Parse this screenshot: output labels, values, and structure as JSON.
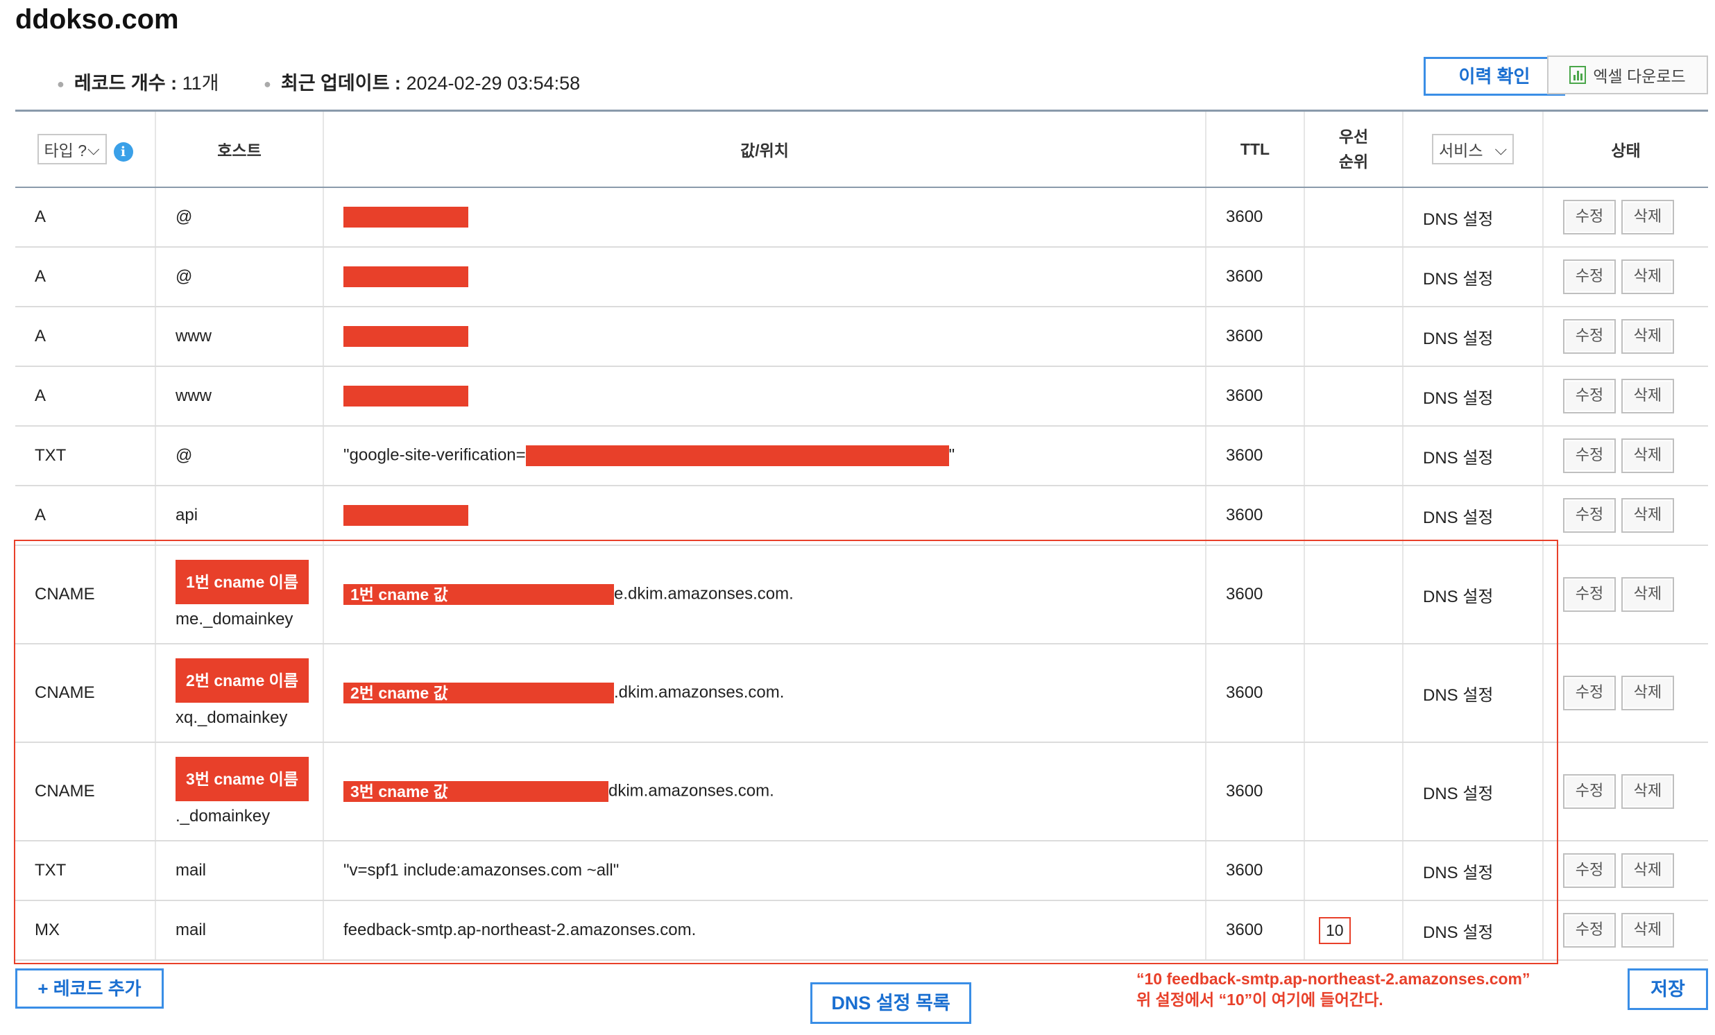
{
  "domain": "ddokso.com",
  "meta": {
    "record_count_label": "레코드 개수 :",
    "record_count_value": "11개",
    "last_update_label": "최근 업데이트 :",
    "last_update_value": "2024-02-29 03:54:58"
  },
  "toolbar": {
    "history_label": "이력 확인",
    "excel_label": "엑셀 다운로드"
  },
  "columns": {
    "type_select": "타입 ?",
    "host": "호스트",
    "value": "값/위치",
    "ttl": "TTL",
    "priority_line1": "우선",
    "priority_line2": "순위",
    "service_select": "서비스",
    "status": "상태"
  },
  "row_buttons": {
    "edit": "수정",
    "delete": "삭제"
  },
  "records": [
    {
      "type": "A",
      "host": "@",
      "value_prefix": "",
      "value_suffix": "",
      "ttl": "3600",
      "priority": "",
      "service": "DNS 설정"
    },
    {
      "type": "A",
      "host": "@",
      "value_prefix": "",
      "value_suffix": "",
      "ttl": "3600",
      "priority": "",
      "service": "DNS 설정"
    },
    {
      "type": "A",
      "host": "www",
      "value_prefix": "",
      "value_suffix": "",
      "ttl": "3600",
      "priority": "",
      "service": "DNS 설정"
    },
    {
      "type": "A",
      "host": "www",
      "value_prefix": "",
      "value_suffix": "",
      "ttl": "3600",
      "priority": "",
      "service": "DNS 설정"
    },
    {
      "type": "TXT",
      "host": "@",
      "value_prefix": "\"google-site-verification=",
      "value_suffix": "\"",
      "ttl": "3600",
      "priority": "",
      "service": "DNS 설정"
    },
    {
      "type": "A",
      "host": "api",
      "value_prefix": "",
      "value_suffix": "",
      "ttl": "3600",
      "priority": "",
      "service": "DNS 설정"
    },
    {
      "type": "CNAME",
      "host_label": "1번 cname 이름",
      "host": "me._domainkey",
      "value_label": "1번 cname 값",
      "value_suffix": "e.dkim.amazonses.com.",
      "ttl": "3600",
      "priority": "",
      "service": "DNS 설정"
    },
    {
      "type": "CNAME",
      "host_label": "2번 cname 이름",
      "host": "xq._domainkey",
      "value_label": "2번 cname 값",
      "value_suffix": ".dkim.amazonses.com.",
      "ttl": "3600",
      "priority": "",
      "service": "DNS 설정"
    },
    {
      "type": "CNAME",
      "host_label": "3번 cname 이름",
      "host": "._domainkey",
      "value_label": "3번 cname 값",
      "value_suffix": "dkim.amazonses.com.",
      "ttl": "3600",
      "priority": "",
      "service": "DNS 설정"
    },
    {
      "type": "TXT",
      "host": "mail",
      "value_text": "\"v=spf1 include:amazonses.com ~all\"",
      "ttl": "3600",
      "priority": "",
      "service": "DNS 설정"
    },
    {
      "type": "MX",
      "host": "mail",
      "value_text": "feedback-smtp.ap-northeast-2.amazonses.com.",
      "ttl": "3600",
      "priority": "10",
      "service": "DNS 설정"
    }
  ],
  "footer": {
    "add_record": "+ 레코드 추가",
    "dns_list": "DNS 설정 목록",
    "save": "저장",
    "note_line1": "“10 feedback-smtp.ap-northeast-2.amazonses.com”",
    "note_line2": "위 설정에서 “10”이 여기에 들어간다."
  },
  "colors": {
    "accent_blue": "#3a8ee6",
    "annotation_red": "#e8402a",
    "info_blue": "#3aa0e8",
    "excel_green": "#4aa64a"
  },
  "icons": [
    "info-icon",
    "chevron-down-icon",
    "excel-icon"
  ]
}
